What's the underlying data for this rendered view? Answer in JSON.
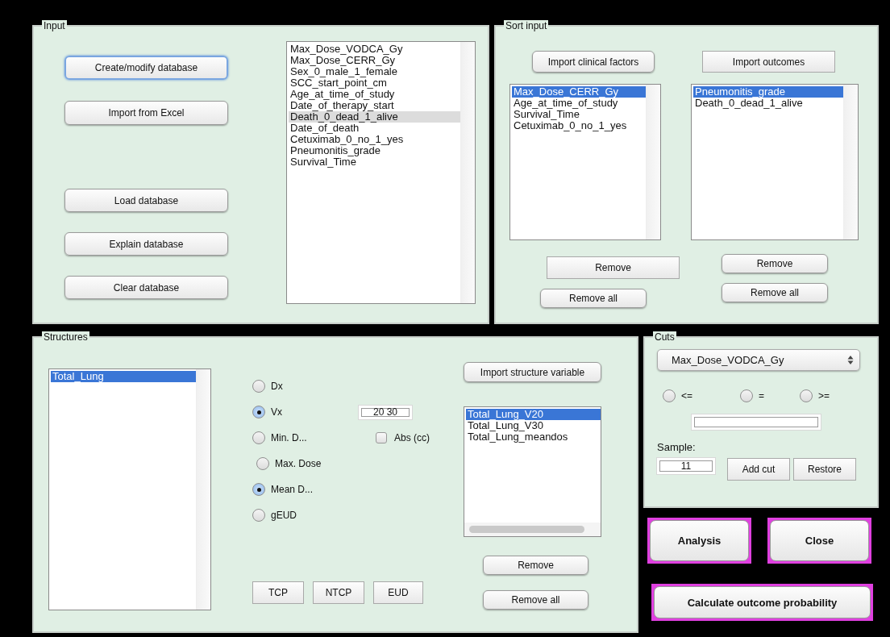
{
  "input_panel": {
    "title": "Input",
    "top_buttons": [
      {
        "label": "Create/modify database",
        "kind": "rounded",
        "focused": true
      },
      {
        "label": "Import from Excel",
        "kind": "rounded",
        "focused": false
      }
    ],
    "bottom_buttons": [
      {
        "label": "Load database",
        "kind": "rounded",
        "focused": false
      },
      {
        "label": "Explain database",
        "kind": "rounded",
        "focused": false
      },
      {
        "label": "Clear database",
        "kind": "rounded",
        "focused": false
      }
    ],
    "listbox": {
      "focused": false,
      "items": [
        {
          "label": "Max_Dose_VODCA_Gy",
          "selected": false
        },
        {
          "label": "Max_Dose_CERR_Gy",
          "selected": false
        },
        {
          "label": "Sex_0_male_1_female",
          "selected": false
        },
        {
          "label": "SCC_start_point_cm",
          "selected": false
        },
        {
          "label": "Age_at_time_of_study",
          "selected": false
        },
        {
          "label": "Date_of_therapy_start",
          "selected": false
        },
        {
          "label": "Death_0_dead_1_alive",
          "selected": true
        },
        {
          "label": "Date_of_death",
          "selected": false
        },
        {
          "label": "Cetuximab_0_no_1_yes",
          "selected": false
        },
        {
          "label": "Pneumonitis_grade",
          "selected": false
        },
        {
          "label": "Survival_Time",
          "selected": false
        }
      ]
    }
  },
  "sort_panel": {
    "title": "Sort input",
    "columns": [
      {
        "import_button": {
          "label": "Import clinical factors",
          "kind": "rounded"
        },
        "listbox": {
          "focused": true,
          "items": [
            {
              "label": "Max_Dose_CERR_Gy",
              "selected": true
            },
            {
              "label": "Age_at_time_of_study",
              "selected": false
            },
            {
              "label": "Survival_Time",
              "selected": false
            },
            {
              "label": "Cetuximab_0_no_1_yes",
              "selected": false
            }
          ]
        },
        "remove_button": {
          "label": "Remove",
          "kind": "square"
        },
        "remove_all_button": {
          "label": "Remove all",
          "kind": "rounded"
        }
      },
      {
        "import_button": {
          "label": "Import outcomes",
          "kind": "square"
        },
        "listbox": {
          "focused": true,
          "items": [
            {
              "label": "Pneumonitis_grade",
              "selected": true
            },
            {
              "label": "Death_0_dead_1_alive",
              "selected": false
            }
          ]
        },
        "remove_button": {
          "label": "Remove",
          "kind": "rounded"
        },
        "remove_all_button": {
          "label": "Remove all",
          "kind": "rounded"
        }
      }
    ]
  },
  "structures_panel": {
    "title": "Structures",
    "structure_list": {
      "focused": true,
      "items": [
        {
          "label": "Total_Lung",
          "selected": true
        }
      ]
    },
    "options": [
      {
        "label": "Dx",
        "checked": false
      },
      {
        "label": "Vx",
        "checked": true
      },
      {
        "label": "Min. D...",
        "checked": false
      },
      {
        "label": "Max. Dose",
        "checked": false
      },
      {
        "label": "Mean D...",
        "checked": true
      },
      {
        "label": "gEUD",
        "checked": false
      }
    ],
    "threshold_field": {
      "value": "20 30"
    },
    "abs_checkbox": {
      "label": "Abs (cc)",
      "checked": false
    },
    "metric_buttons": [
      {
        "label": "TCP",
        "kind": "square"
      },
      {
        "label": "NTCP",
        "kind": "square"
      },
      {
        "label": "EUD",
        "kind": "square"
      }
    ],
    "import_button": {
      "label": "Import structure variable",
      "kind": "rounded"
    },
    "variable_list": {
      "focused": true,
      "items": [
        {
          "label": "Total_Lung_V20",
          "selected": true
        },
        {
          "label": "Total_Lung_V30",
          "selected": false
        },
        {
          "label": "Total_Lung_meandos",
          "selected": false
        }
      ]
    },
    "remove_button": {
      "label": "Remove",
      "kind": "rounded"
    },
    "remove_all_button": {
      "label": "Remove all",
      "kind": "rounded"
    }
  },
  "cuts_panel": {
    "title": "Cuts",
    "variable_select": {
      "value": "Max_Dose_VODCA_Gy"
    },
    "operators": [
      {
        "label": "<=",
        "selected": false
      },
      {
        "label": "=",
        "selected": false
      },
      {
        "label": ">=",
        "selected": false
      }
    ],
    "sample_label": "Sample:",
    "sample_field": {
      "value": "11"
    },
    "buttons": [
      {
        "label": "Add cut",
        "kind": "square"
      },
      {
        "label": "Restore",
        "kind": "square"
      }
    ]
  },
  "actions": [
    {
      "label": "Analysis",
      "highlighted": true
    },
    {
      "label": "Close",
      "highlighted": true
    },
    {
      "label": "Calculate outcome probability",
      "highlighted": true
    }
  ]
}
